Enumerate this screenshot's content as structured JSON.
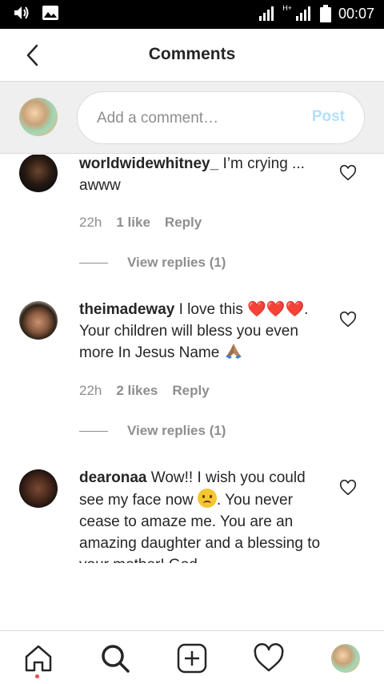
{
  "status_bar": {
    "time": "00:07",
    "network_label": "H+",
    "icons": [
      "volume-icon",
      "image-icon",
      "signal-icon",
      "battery-icon"
    ]
  },
  "header": {
    "title": "Comments",
    "back_icon": "chevron-left-icon"
  },
  "composer": {
    "placeholder": "Add a comment…",
    "post_label": "Post",
    "post_color": "#b2dffc"
  },
  "comments": [
    {
      "username": "worldwidewhitney_",
      "text": "I’m crying ... awww",
      "time": "22h",
      "likes": "1 like",
      "reply_label": "Reply",
      "view_replies": "View replies (1)"
    },
    {
      "username": "theimadeway",
      "text": "I love this ❤️❤️❤️. Your children will bless you even more In Jesus Name",
      "time": "22h",
      "likes": "2 likes",
      "reply_label": "Reply",
      "view_replies": "View replies (1)"
    },
    {
      "username": "dearonaa",
      "text_before_emoji": "Wow!! I wish you could see my face now",
      "text_after_emoji": ". You never cease to amaze me. You are an amazing daughter and a blessing to your mother! God",
      "emoji": "sad-face-emoji"
    }
  ],
  "bottom_nav": {
    "items": [
      "home-icon",
      "search-icon",
      "add-post-icon",
      "heart-icon",
      "profile-avatar"
    ],
    "notification_color": "#ed4956"
  }
}
